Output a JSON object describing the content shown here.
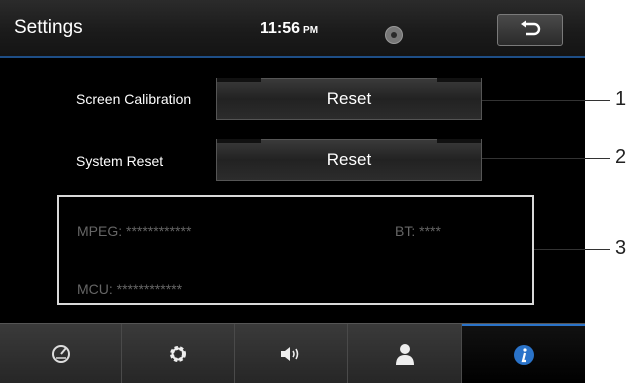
{
  "header": {
    "title": "Settings",
    "time": "11:56",
    "ampm": "PM"
  },
  "rows": [
    {
      "label": "Screen Calibration",
      "button": "Reset"
    },
    {
      "label": "System Reset",
      "button": "Reset"
    }
  ],
  "info": {
    "mpeg": "MPEG: ************",
    "bt": "BT: ****",
    "mcu": "MCU: ************"
  },
  "tabs": [
    {
      "icon": "gauge-icon",
      "active": false
    },
    {
      "icon": "gear-icon",
      "active": false
    },
    {
      "icon": "speaker-icon",
      "active": false
    },
    {
      "icon": "user-icon",
      "active": false
    },
    {
      "icon": "info-icon",
      "active": true
    }
  ],
  "callouts": [
    "1",
    "2",
    "3"
  ],
  "colors": {
    "accent": "#2a73c9",
    "header_rule": "#1e4e86",
    "info_border": "#d8d8d8"
  }
}
